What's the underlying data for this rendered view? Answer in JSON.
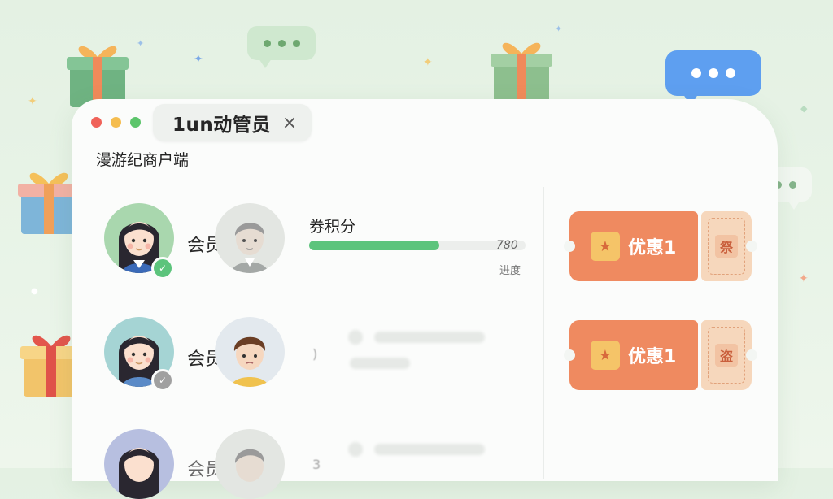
{
  "window": {
    "tab_title": "1un动管员",
    "close_glyph": "×",
    "subtitle": "漫游纪商户端"
  },
  "rows": [
    {
      "member_label": "会员",
      "status": "verified",
      "points": {
        "title": "券积分",
        "value_text": "780",
        "fill_fraction": 0.6,
        "caption": "进度"
      },
      "coupon": {
        "label": "优惠1",
        "stub_glyph": "祭"
      }
    },
    {
      "member_label": "会员",
      "status": "pending",
      "faint_text": ")",
      "coupon": {
        "label": "优惠1",
        "stub_glyph": "盗"
      }
    },
    {
      "member_label": "会员",
      "status": "none",
      "faint_text": "3"
    }
  ],
  "colors": {
    "accent_green": "#5cc47c",
    "coupon_orange": "#ef8a60",
    "coupon_stub": "#f6d7bc",
    "bubble_blue": "#5e9ff0"
  }
}
